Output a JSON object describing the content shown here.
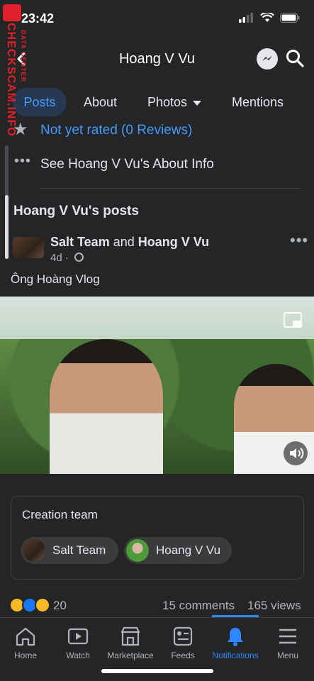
{
  "status_bar": {
    "time": "23:42"
  },
  "header": {
    "title": "Hoang V Vu",
    "icons": [
      "back-arrow-icon",
      "messenger-icon",
      "search-icon"
    ]
  },
  "tabs": [
    {
      "label": "Posts",
      "active": true
    },
    {
      "label": "About"
    },
    {
      "label": "Photos"
    },
    {
      "label": "Mentions"
    }
  ],
  "rating": {
    "text": "Not yet rated (0 Reviews)",
    "icon": "star-icon"
  },
  "about_info": {
    "text": "See Hoang V Vu's About Info",
    "icon": "more-dots-icon"
  },
  "posts_heading": "Hoang V Vu's posts",
  "post": {
    "author_1": "Salt Team",
    "connector": "and",
    "author_2": "Hoang V Vu",
    "time": "4d",
    "separator": "·",
    "caption": "Ông Hoàng Vlog"
  },
  "watermark": {
    "main": "CHECKSCAM.INFO",
    "sub": "DATA CENTER"
  },
  "creation_team": {
    "title": "Creation team",
    "members": [
      {
        "name": "Salt Team"
      },
      {
        "name": "Hoang V Vu"
      }
    ]
  },
  "reactions": {
    "count": "20",
    "icons": [
      "haha-icon",
      "like-icon",
      "sad-icon"
    ],
    "comments": "15 comments",
    "views": "165 views"
  },
  "bottom_nav": [
    {
      "label": "Home",
      "icon": "home-icon"
    },
    {
      "label": "Watch",
      "icon": "watch-icon"
    },
    {
      "label": "Marketplace",
      "icon": "marketplace-icon"
    },
    {
      "label": "Feeds",
      "icon": "feeds-icon"
    },
    {
      "label": "Notifications",
      "icon": "bell-icon",
      "active": true
    },
    {
      "label": "Menu",
      "icon": "menu-icon"
    }
  ],
  "colors": {
    "accent": "#2d88ff",
    "link": "#4599ff",
    "background": "#242526"
  }
}
